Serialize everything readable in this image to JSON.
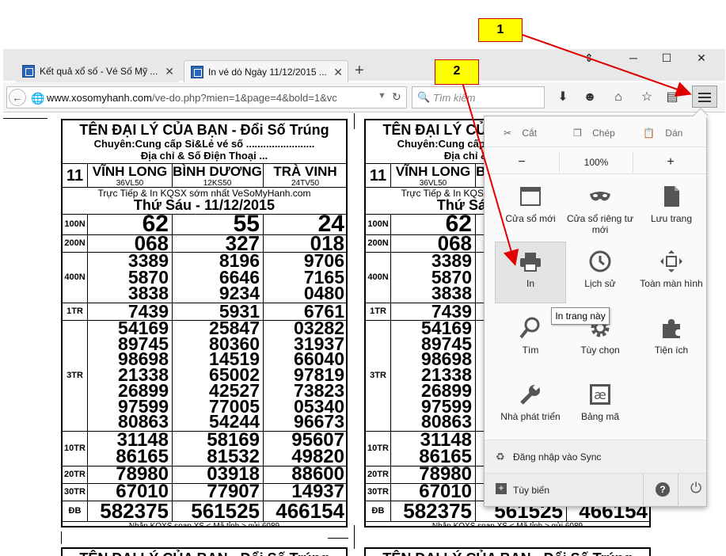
{
  "tabs": [
    {
      "label": "Kết quả xổ số - Vé Số Mỹ ..."
    },
    {
      "label": "In vé dò Ngày 11/12/2015 ..."
    }
  ],
  "toolbar": {
    "url_host": "www.xosomyhanh.com",
    "url_path": "/ve-do.php?mien=1&page=4&bold=1&vc",
    "search_placeholder": "Tìm kiếm"
  },
  "ticket": {
    "title": "TÊN ĐẠI LÝ CỦA BẠN - Đổi Số Trúng",
    "line1": "Chuyên:Cung cấp Sỉ&Lẻ vé số ........................",
    "line2": "Địa chỉ & Số Điện Thoại ...",
    "day_num": "11",
    "provinces": [
      {
        "name": "VĨNH LONG",
        "code": "36VL50"
      },
      {
        "name": "BÌNH DƯƠNG",
        "code": "12KS50"
      },
      {
        "name": "TRÀ VINH",
        "code": "24TV50"
      }
    ],
    "promo": "Trực Tiếp & In KQSX sớm nhất VeSoMyHanh.com",
    "date": "Thứ Sáu - 11/12/2015",
    "prizes": [
      {
        "label": "100N",
        "values": [
          [
            "62"
          ],
          [
            "55"
          ],
          [
            "24"
          ]
        ]
      },
      {
        "label": "200N",
        "values": [
          [
            "068"
          ],
          [
            "327"
          ],
          [
            "018"
          ]
        ]
      },
      {
        "label": "400N",
        "values": [
          [
            "3389",
            "5870",
            "3838"
          ],
          [
            "8196",
            "6646",
            "9234"
          ],
          [
            "9706",
            "7165",
            "0480"
          ]
        ]
      },
      {
        "label": "1TR",
        "values": [
          [
            "7439"
          ],
          [
            "5931"
          ],
          [
            "6761"
          ]
        ]
      },
      {
        "label": "3TR",
        "values": [
          [
            "54169",
            "89745",
            "98698",
            "21338",
            "26899",
            "97599",
            "80863"
          ],
          [
            "25847",
            "80360",
            "14519",
            "65002",
            "42527",
            "77005",
            "54244"
          ],
          [
            "03282",
            "31937",
            "66040",
            "97819",
            "73823",
            "05340",
            "96673"
          ]
        ]
      },
      {
        "label": "10TR",
        "values": [
          [
            "31148",
            "86165"
          ],
          [
            "58169",
            "81532"
          ],
          [
            "95607",
            "49820"
          ]
        ]
      },
      {
        "label": "20TR",
        "values": [
          [
            "78980"
          ],
          [
            "03918"
          ],
          [
            "88600"
          ]
        ]
      },
      {
        "label": "30TR",
        "values": [
          [
            "67010"
          ],
          [
            "77907"
          ],
          [
            "14937"
          ]
        ]
      },
      {
        "label": "ĐB",
        "values": [
          [
            "582375"
          ],
          [
            "561525"
          ],
          [
            "466154"
          ]
        ]
      }
    ],
    "footer": "Nhắn KQXS soạn XS < Mã tỉnh > gửi 6089"
  },
  "menu": {
    "edit": {
      "cut": "Cắt",
      "copy": "Chép",
      "paste": "Dán"
    },
    "zoom": {
      "minus": "−",
      "level": "100%",
      "plus": "+"
    },
    "items": [
      {
        "label": "Cửa sổ mới"
      },
      {
        "label": "Cửa sổ riêng tư mới"
      },
      {
        "label": "Lưu trang"
      },
      {
        "label": "In"
      },
      {
        "label": "Lịch sử"
      },
      {
        "label": "Toàn màn hình"
      },
      {
        "label": "Tìm"
      },
      {
        "label": "Tùy chọn"
      },
      {
        "label": "Tiện ích"
      },
      {
        "label": "Nhà phát triển"
      },
      {
        "label": "Bảng mã"
      }
    ],
    "sync": "Đăng nhập vào Sync",
    "customize": "Tùy biến",
    "tooltip": "In trang này"
  },
  "callouts": {
    "one": "1",
    "two": "2"
  },
  "colors": {
    "callout_bg": "#ffff00",
    "arrow": "#e00000",
    "highlight": "#e4e4e4"
  }
}
